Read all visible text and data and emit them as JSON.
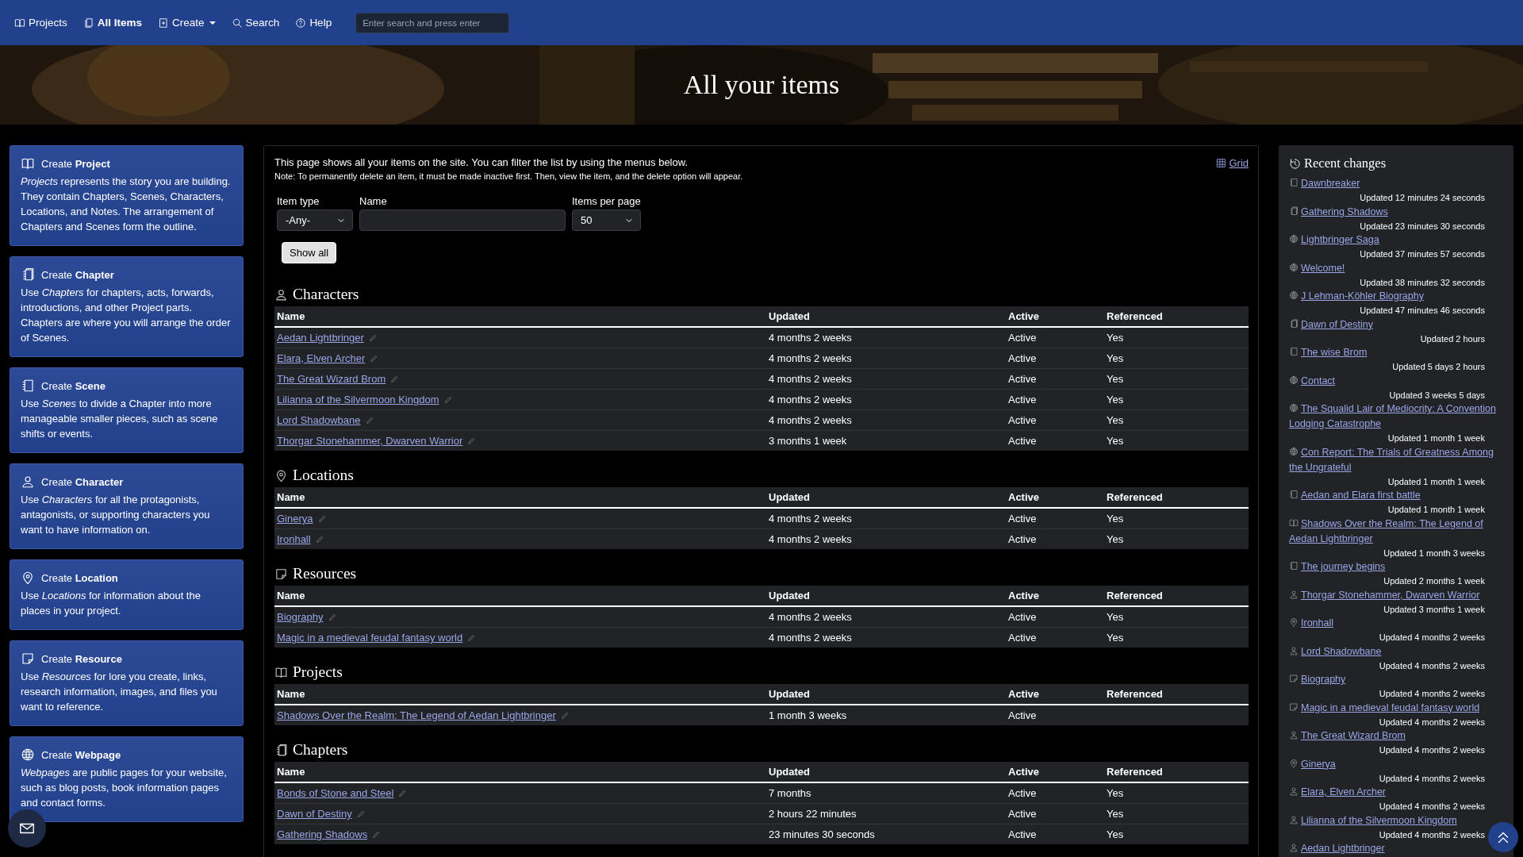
{
  "nav": {
    "items": [
      {
        "label": "Projects",
        "kind": "projects",
        "selected": false
      },
      {
        "label": "All Items",
        "kind": "items",
        "selected": true
      },
      {
        "label": "Create",
        "kind": "create",
        "selected": false
      },
      {
        "label": "Search",
        "kind": "search",
        "selected": false
      },
      {
        "label": "Help",
        "kind": "help",
        "selected": false
      }
    ],
    "search": {
      "placeholder": "Enter search and press enter"
    }
  },
  "hero": {
    "title": "All your items"
  },
  "create_cards": [
    {
      "title": "Create **Project**",
      "kind": "project",
      "description": "*Projects* represents the story you are building. They contain Chapters, Scenes, Characters, Locations, and Notes. The arrangement of Chapters and Scenes form the outline."
    },
    {
      "title": "Create **Chapter**",
      "kind": "chapter",
      "description": "Use *Chapters* for chapters, acts, forwards, introductions, and other Project parts. Chapters are where you will arrange the order of Scenes."
    },
    {
      "title": "Create **Scene**",
      "kind": "scene",
      "description": "Use *Scenes* to divide a Chapter into more manageable smaller pieces, such as scene shifts or events."
    },
    {
      "title": "Create **Character**",
      "kind": "character",
      "description": "Use *Characters* for all the protagonists, antagonists, or supporting characters you want to have information on."
    },
    {
      "title": "Create **Location**",
      "kind": "location",
      "description": "Use *Locations* for information about the places in your project."
    },
    {
      "title": "Create **Resource**",
      "kind": "resource",
      "description": "Use *Resources* for lore you create, links, research information, images, and files you want to reference."
    },
    {
      "title": "Create **Webpage**",
      "kind": "webpage",
      "description": "*Webpages* are public pages for your website, such as blog posts, book information pages and contact forms."
    }
  ],
  "intro": {
    "text": "This page shows all your items on the site. You can filter the list by using the menus below.",
    "note": "Note: To permanently delete an item, it must be made inactive first. Then, view the item, and the delete option will appear.",
    "view_link": "Grid"
  },
  "filters": {
    "item_type": {
      "label": "Item type",
      "value": "-Any-"
    },
    "name": {
      "label": "Name"
    },
    "items_per_page": {
      "label": "Items per page",
      "value": "50"
    },
    "button": "Show all"
  },
  "sections": [
    {
      "title": "Characters",
      "kind": "character",
      "columns": [
        "Name",
        "Updated",
        "Active",
        "Referenced"
      ],
      "rows": [
        {
          "name": "Aedan Lightbringer",
          "updated": "4 months 2 weeks",
          "active": "Active",
          "referenced": "Yes"
        },
        {
          "name": "Elara, Elven Archer",
          "updated": "4 months 2 weeks",
          "active": "Active",
          "referenced": "Yes"
        },
        {
          "name": "The Great Wizard Brom",
          "updated": "4 months 2 weeks",
          "active": "Active",
          "referenced": "Yes"
        },
        {
          "name": "Lilianna of the Silvermoon Kingdom",
          "updated": "4 months 2 weeks",
          "active": "Active",
          "referenced": "Yes"
        },
        {
          "name": "Lord Shadowbane",
          "updated": "4 months 2 weeks",
          "active": "Active",
          "referenced": "Yes"
        },
        {
          "name": "Thorgar Stonehammer, Dwarven Warrior",
          "updated": "3 months 1 week",
          "active": "Active",
          "referenced": "Yes"
        }
      ]
    },
    {
      "title": "Locations",
      "kind": "location",
      "columns": [
        "Name",
        "Updated",
        "Active",
        "Referenced"
      ],
      "rows": [
        {
          "name": "Ginerya",
          "updated": "4 months 2 weeks",
          "active": "Active",
          "referenced": "Yes"
        },
        {
          "name": "Ironhall",
          "updated": "4 months 2 weeks",
          "active": "Active",
          "referenced": "Yes"
        }
      ]
    },
    {
      "title": "Resources",
      "kind": "resource",
      "columns": [
        "Name",
        "Updated",
        "Active",
        "Referenced"
      ],
      "rows": [
        {
          "name": "Biography",
          "updated": "4 months 2 weeks",
          "active": "Active",
          "referenced": "Yes"
        },
        {
          "name": "Magic in a medieval feudal fantasy world",
          "updated": "4 months 2 weeks",
          "active": "Active",
          "referenced": "Yes"
        }
      ]
    },
    {
      "title": "Projects",
      "kind": "project",
      "columns": [
        "Name",
        "Updated",
        "Active",
        "Referenced"
      ],
      "rows": [
        {
          "name": "Shadows Over the Realm: The Legend of Aedan Lightbringer",
          "updated": "1 month 3 weeks",
          "active": "Active"
        }
      ]
    },
    {
      "title": "Chapters",
      "kind": "chapter",
      "columns": [
        "Name",
        "Updated",
        "Active",
        "Referenced"
      ],
      "rows": [
        {
          "name": "Bonds of Stone and Steel",
          "updated": "7 months",
          "active": "Active",
          "referenced": "Yes"
        },
        {
          "name": "Dawn of Destiny",
          "updated": "2 hours 22 minutes",
          "active": "Active",
          "referenced": "Yes"
        },
        {
          "name": "Gathering Shadows",
          "updated": "23 minutes 30 seconds",
          "active": "Active",
          "referenced": "Yes"
        }
      ]
    }
  ],
  "recent": {
    "title": "Recent changes",
    "items": [
      {
        "name": "Dawnbreaker",
        "kind": "scene",
        "updated": "Updated 12 minutes 24 seconds"
      },
      {
        "name": "Gathering Shadows",
        "kind": "chapter",
        "updated": "Updated 23 minutes 30 seconds"
      },
      {
        "name": "Lightbringer Saga",
        "kind": "webpage",
        "updated": "Updated 37 minutes 57 seconds"
      },
      {
        "name": "Welcome!",
        "kind": "webpage",
        "updated": "Updated 38 minutes 32 seconds"
      },
      {
        "name": "J Lehman-Köhler Biography",
        "kind": "webpage",
        "updated": "Updated 47 minutes 46 seconds"
      },
      {
        "name": "Dawn of Destiny",
        "kind": "chapter",
        "updated": "Updated 2 hours"
      },
      {
        "name": "The wise Brom",
        "kind": "scene",
        "updated": "Updated 5 days 2 hours"
      },
      {
        "name": "Contact",
        "kind": "webpage",
        "updated": "Updated 3 weeks 5 days"
      },
      {
        "name": "The Squalid Lair of Mediocrity: A Convention Lodging Catastrophe",
        "kind": "webpage",
        "updated": "Updated 1 month 1 week"
      },
      {
        "name": "Con Report: The Trials of Greatness Among the Ungrateful",
        "kind": "webpage",
        "updated": "Updated 1 month 1 week"
      },
      {
        "name": "Aedan and Elara first battle",
        "kind": "scene",
        "updated": "Updated 1 month 1 week"
      },
      {
        "name": "Shadows Over the Realm: The Legend of Aedan Lightbringer",
        "kind": "project",
        "updated": "Updated 1 month 3 weeks"
      },
      {
        "name": "The journey begins",
        "kind": "scene",
        "updated": "Updated 2 months 1 week"
      },
      {
        "name": "Thorgar Stonehammer, Dwarven Warrior",
        "kind": "character",
        "updated": "Updated 3 months 1 week"
      },
      {
        "name": "Ironhall",
        "kind": "location",
        "updated": "Updated 4 months 2 weeks"
      },
      {
        "name": "Lord Shadowbane",
        "kind": "character",
        "updated": "Updated 4 months 2 weeks"
      },
      {
        "name": "Biography",
        "kind": "resource",
        "updated": "Updated 4 months 2 weeks"
      },
      {
        "name": "Magic in a medieval feudal fantasy world",
        "kind": "resource",
        "updated": "Updated 4 months 2 weeks"
      },
      {
        "name": "The Great Wizard Brom",
        "kind": "character",
        "updated": "Updated 4 months 2 weeks"
      },
      {
        "name": "Ginerya",
        "kind": "location",
        "updated": "Updated 4 months 2 weeks"
      },
      {
        "name": "Elara, Elven Archer",
        "kind": "character",
        "updated": "Updated 4 months 2 weeks"
      },
      {
        "name": "Lilianna of the Silvermoon Kingdom",
        "kind": "character",
        "updated": "Updated 4 months 2 weeks"
      },
      {
        "name": "Aedan Lightbringer",
        "kind": "character"
      }
    ]
  }
}
